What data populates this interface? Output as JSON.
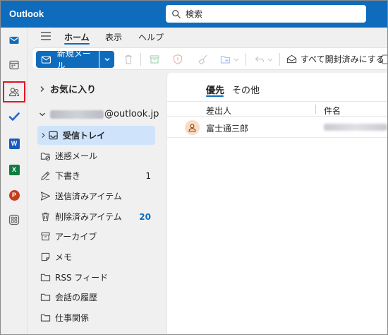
{
  "app": {
    "title": "Outlook"
  },
  "search": {
    "placeholder": "検索"
  },
  "rail": {
    "items": [
      {
        "name": "mail-icon",
        "app": "mail"
      },
      {
        "name": "calendar-icon",
        "app": "calendar"
      },
      {
        "name": "people-icon",
        "app": "people",
        "highlighted": true
      },
      {
        "name": "todo-icon",
        "app": "todo"
      },
      {
        "name": "word-icon",
        "app": "word",
        "letter": "W",
        "color": "#185abd"
      },
      {
        "name": "excel-icon",
        "app": "excel",
        "letter": "X",
        "color": "#107c41"
      },
      {
        "name": "powerpoint-icon",
        "app": "powerpoint",
        "letter": "P",
        "color": "#c43e1c"
      },
      {
        "name": "more-apps-icon",
        "app": "more"
      }
    ]
  },
  "ribbon": {
    "tabs": [
      {
        "label": "ホーム",
        "active": true
      },
      {
        "label": "表示",
        "active": false
      },
      {
        "label": "ヘルプ",
        "active": false
      }
    ],
    "new_mail_label": "新規メール",
    "mark_all_read_label": "すべて開封済みにする"
  },
  "folders": {
    "favorites_label": "お気に入り",
    "account_suffix": "@outlook.jp",
    "items": [
      {
        "label": "受信トレイ",
        "icon": "inbox-icon",
        "selected": true,
        "count": ""
      },
      {
        "label": "迷惑メール",
        "icon": "junk-icon",
        "selected": false,
        "count": ""
      },
      {
        "label": "下書き",
        "icon": "drafts-icon",
        "selected": false,
        "count": "1"
      },
      {
        "label": "送信済みアイテム",
        "icon": "sent-icon",
        "selected": false,
        "count": ""
      },
      {
        "label": "削除済みアイテム",
        "icon": "trash-icon",
        "selected": false,
        "count": "20"
      },
      {
        "label": "アーカイブ",
        "icon": "archive-icon",
        "selected": false,
        "count": ""
      },
      {
        "label": "メモ",
        "icon": "notes-icon",
        "selected": false,
        "count": ""
      },
      {
        "label": "RSS フィード",
        "icon": "folder-icon",
        "selected": false,
        "count": ""
      },
      {
        "label": "会話の履歴",
        "icon": "folder-icon",
        "selected": false,
        "count": ""
      },
      {
        "label": "仕事関係",
        "icon": "folder-icon",
        "selected": false,
        "count": ""
      }
    ]
  },
  "message_list": {
    "focused_tab": "優先",
    "other_tab": "その他",
    "columns": {
      "sender": "差出人",
      "subject": "件名"
    },
    "rows": [
      {
        "sender": "富士通三郎"
      }
    ]
  },
  "colors": {
    "accent": "#0f6cbd",
    "highlight_box": "#e81123",
    "selected_folder_bg": "#cfe4fa"
  }
}
